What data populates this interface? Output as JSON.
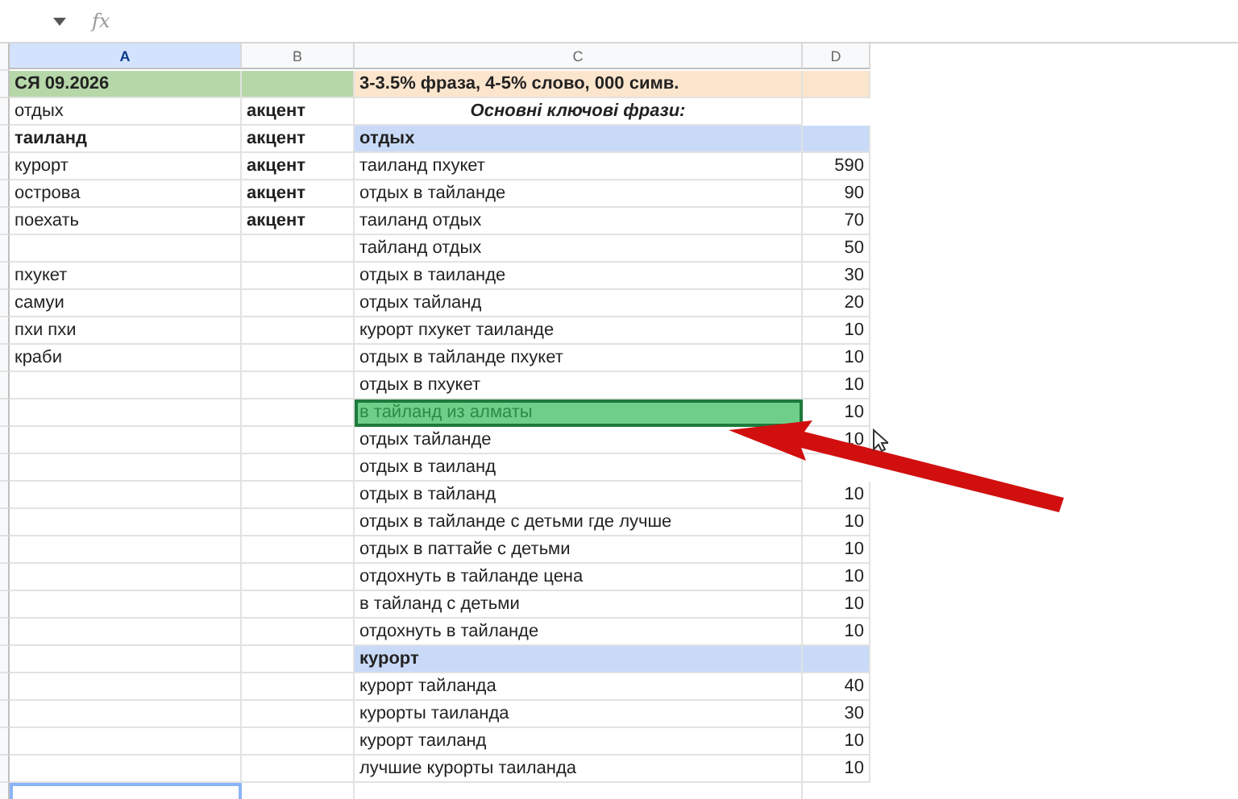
{
  "formula_bar": {
    "fx_label": "fx"
  },
  "columns": [
    {
      "label": "A",
      "selected": true
    },
    {
      "label": "B",
      "selected": false
    },
    {
      "label": "C",
      "selected": false
    },
    {
      "label": "D",
      "selected": false
    }
  ],
  "rows": [
    {
      "kind": "title",
      "a": "СЯ 09.2026",
      "c": "3-3.5% фраза, 4-5% слово, 000 симв.",
      "selected": false,
      "active": false
    },
    {
      "kind": "subtitle",
      "a": "отдых",
      "b": "акцент",
      "c": "Основні ключові фрази:",
      "selected": false,
      "active": false
    },
    {
      "kind": "group",
      "a": "таиланд",
      "b": "акцент",
      "c": "отдых",
      "selected": false,
      "active": false
    },
    {
      "kind": "data",
      "a": "курорт",
      "b": "акцент",
      "c": "таиланд пхукет",
      "d": "590",
      "selected": false,
      "active": false
    },
    {
      "kind": "data",
      "a": "острова",
      "b": "акцент",
      "c": "отдых в тайланде",
      "d": "90",
      "selected": false,
      "active": false
    },
    {
      "kind": "data",
      "a": "поехать",
      "b": "акцент",
      "c": "таиланд отдых",
      "d": "70",
      "selected": false,
      "active": false
    },
    {
      "kind": "data",
      "c": "тайланд отдых",
      "d": "50",
      "selected": false,
      "active": false
    },
    {
      "kind": "data",
      "a": "пхукет",
      "c": "отдых в таиланде",
      "d": "30",
      "selected": false,
      "active": false
    },
    {
      "kind": "data",
      "a": "самуи",
      "c": "отдых тайланд",
      "d": "20",
      "selected": false,
      "active": false
    },
    {
      "kind": "data",
      "a": "пхи пхи",
      "c": "курорт пхукет таиланде",
      "d": "10",
      "selected": false,
      "active": false
    },
    {
      "kind": "data",
      "a": "краби",
      "c": "отдых в тайланде пхукет",
      "d": "10",
      "selected": false,
      "active": false
    },
    {
      "kind": "data",
      "c": "отдых в пхукет",
      "d": "10",
      "selected": false,
      "active": false
    },
    {
      "kind": "data",
      "c": "в тайланд из алматы",
      "d": "10",
      "selected": true,
      "active": false
    },
    {
      "kind": "data",
      "c": "отдых тайланде",
      "d": "10",
      "selected": false,
      "active": false
    },
    {
      "kind": "data",
      "c": "отдых в таиланд",
      "selected": false,
      "active": false
    },
    {
      "kind": "data",
      "c": "отдых в тайланд",
      "d": "10",
      "selected": false,
      "active": false
    },
    {
      "kind": "data",
      "c": "отдых в тайланде с детьми где лучше",
      "d": "10",
      "selected": false,
      "active": false
    },
    {
      "kind": "data",
      "c": "отдых в паттайе с детьми",
      "d": "10",
      "selected": false,
      "active": false
    },
    {
      "kind": "data",
      "c": "отдохнуть в тайланде цена",
      "d": "10",
      "selected": false,
      "active": false
    },
    {
      "kind": "data",
      "c": "в тайланд с детьми",
      "d": "10",
      "selected": false,
      "active": false
    },
    {
      "kind": "data",
      "c": "отдохнуть в тайланде",
      "d": "10",
      "selected": false,
      "active": false
    },
    {
      "kind": "group",
      "c": "курорт",
      "selected": false,
      "active": false
    },
    {
      "kind": "data",
      "c": "курорт тайланда",
      "d": "40",
      "selected": false,
      "active": false
    },
    {
      "kind": "data",
      "c": "курорты таиланда",
      "d": "30",
      "selected": false,
      "active": false
    },
    {
      "kind": "data",
      "c": "курорт таиланд",
      "d": "10",
      "selected": false,
      "active": false
    },
    {
      "kind": "data",
      "c": "лучшие курорты таиланда",
      "d": "10",
      "selected": false,
      "active": false
    },
    {
      "kind": "data",
      "selected": false,
      "active": true
    }
  ]
}
